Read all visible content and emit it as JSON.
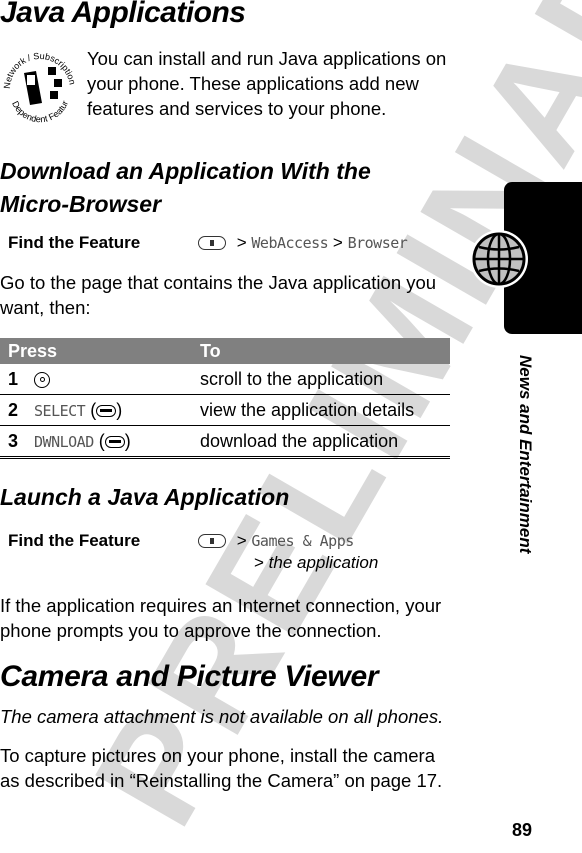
{
  "watermark": "PRELIMINARY",
  "title": "Java Applications",
  "badge": {
    "top_text": "Network / Subscription",
    "bottom_text": "Dependent Feature",
    "icon": "network-subscription-badge-icon"
  },
  "intro": "You can install and run Java applications on your phone. These applications add new features and services to your phone.",
  "section_download": {
    "heading": "Download an Application With the Micro-Browser",
    "find_feature": {
      "label": "Find the Feature",
      "menu_icon": "menu-key-icon",
      "sep": ">",
      "path": [
        "WebAccess",
        "Browser"
      ]
    },
    "instructions": "Go to the page that contains the Java application you want, then:",
    "table": {
      "headers": [
        "Press",
        "To"
      ],
      "rows": [
        {
          "num": "1",
          "key": "",
          "key_icon": "nav-key-icon",
          "action": "scroll to the application"
        },
        {
          "num": "2",
          "key": "SELECT",
          "key_icon": "soft-key-icon",
          "action": "view the application details"
        },
        {
          "num": "3",
          "key": "DWNLOAD",
          "key_icon": "soft-key-icon",
          "action": "download the application"
        }
      ]
    }
  },
  "section_launch": {
    "heading": "Launch a Java Application",
    "find_feature": {
      "label": "Find the Feature",
      "menu_icon": "menu-key-icon",
      "sep": ">",
      "path1": "Games & Apps",
      "path2": "the application"
    },
    "text": "If the application requires an Internet connection, your phone prompts you to approve the connection."
  },
  "section_camera": {
    "heading": "Camera and Picture Viewer",
    "note": "The camera attachment is not available on all phones.",
    "text": "To capture pictures on your phone, install the camera as described in “Reinstalling the Camera” on page 17."
  },
  "sidebar": {
    "label": "News and Entertainment",
    "icon": "globe-icon"
  },
  "page_number": "89"
}
